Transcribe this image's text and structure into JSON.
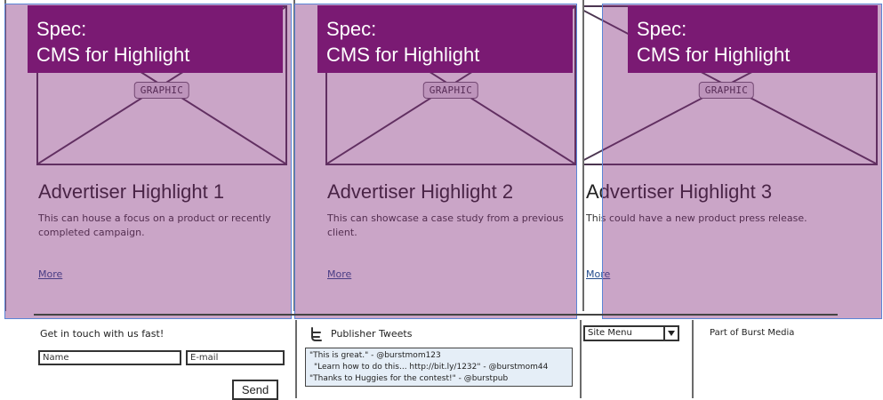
{
  "cards": [
    {
      "graphic_label": "GRAPHIC",
      "title": "Advertiser Highlight 1",
      "body": "This can house a focus on a product or recently completed campaign.",
      "more": "More"
    },
    {
      "graphic_label": "GRAPHIC",
      "title": "Advertiser Highlight 2",
      "body": "This can showcase a case study from a previous client.",
      "more": "More"
    },
    {
      "graphic_label": "GRAPHIC",
      "title": "Advertiser Highlight 3",
      "body": "This could have a new product press release.",
      "more": "More"
    }
  ],
  "spec_banners": [
    {
      "line1": "Spec:",
      "line2": "CMS for Highlight"
    },
    {
      "line1": "Spec:",
      "line2": "CMS for Highlight"
    },
    {
      "line1": "Spec:",
      "line2": "CMS for Highlight"
    }
  ],
  "footer": {
    "contact": {
      "heading": "Get in touch with us fast!",
      "name_placeholder": "Name",
      "email_placeholder": "E-mail",
      "send_label": "Send"
    },
    "tweets": {
      "heading": "Publisher Tweets",
      "items": [
        "\"This is great.\" - @burstmom123",
        "\"Learn how to do this... http://bit.ly/1232\" - @burstmom44",
        "\"Thanks to Huggies for the contest!\" - @burstpub"
      ]
    },
    "site_menu": {
      "selected": "Site Menu"
    },
    "part_of": "Part of Burst Media"
  },
  "colors": {
    "overlay": "#80287a",
    "banner": "#7a1a73",
    "overlay_border": "#5a85d6",
    "link": "#244c8d"
  },
  "icons": {
    "tweet": "twitter-icon",
    "dropdown": "chevron-down-icon"
  }
}
